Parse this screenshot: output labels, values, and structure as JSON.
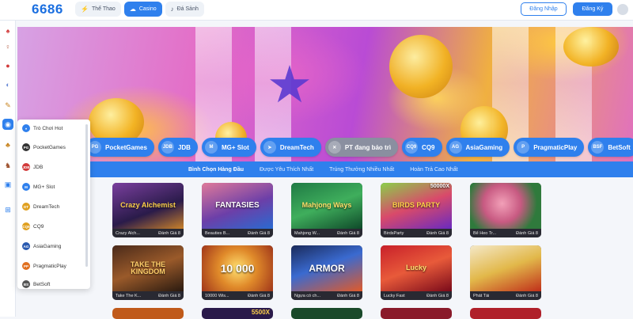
{
  "header": {
    "logo": "6686",
    "tabs": [
      {
        "label": "Thể Thao",
        "icon": "lightning-icon"
      },
      {
        "label": "Casino",
        "icon": "cloud-icon"
      },
      {
        "label": "Đá Sảnh",
        "icon": "mic-icon"
      }
    ],
    "login_label": "Đăng Nhập",
    "register_label": "Đăng Ký"
  },
  "providers": [
    {
      "abbr": "PG",
      "label": "PocketGames"
    },
    {
      "abbr": "JDB",
      "label": "JDB"
    },
    {
      "abbr": "M",
      "label": "MG+ Slot"
    },
    {
      "abbr": "➤",
      "label": "DreamTech"
    },
    {
      "abbr": "✕",
      "label": "PT đang bảo trì"
    },
    {
      "abbr": "CQ9",
      "label": "CQ9"
    },
    {
      "abbr": "AG",
      "label": "AsiaGaming"
    },
    {
      "abbr": "P",
      "label": "PragmaticPlay"
    },
    {
      "abbr": "BSF",
      "label": "BetSoft"
    }
  ],
  "filters": [
    "Bình Chọn Hàng Đầu",
    "Được Yêu Thích Nhất",
    "Trúng Thưởng Nhiều Nhất",
    "Hoàn Trả Cao Nhất"
  ],
  "games": [
    {
      "art": "Crazy Alchemist",
      "name": "Crazy Alch...",
      "rating": "Đánh Giá 8"
    },
    {
      "art": "FANTASIES",
      "name": "Beauties B...",
      "rating": "Đánh Giá 8"
    },
    {
      "art": "Mahjong Ways",
      "name": "Mahjong W...",
      "rating": "Đánh Giá 8"
    },
    {
      "art": "BIRDS PARTY",
      "name": "BirdsParty",
      "rating": "Đánh Giá 8"
    },
    {
      "art": "",
      "name": "Bể Heo Tr...",
      "rating": "Đánh Giá 8"
    },
    {
      "art": "TAKE THE KINGDOM",
      "name": "Take The K...",
      "rating": "Đánh Giá 8"
    },
    {
      "art": "10 000",
      "name": "10000 Wis...",
      "rating": "Đánh Giá 8"
    },
    {
      "art": "ARMOR",
      "name": "Ngựa có ch...",
      "rating": "Đánh Giá 8"
    },
    {
      "art": "Lucky",
      "name": "Lucky Fast",
      "rating": "Đánh Giá 8"
    },
    {
      "art": "",
      "name": "Phát Tài",
      "rating": "Đánh Giá 8"
    }
  ],
  "game_badges": {
    "birds": "50000X",
    "bottom": "5500X"
  },
  "dropdown": [
    {
      "abbr": "♦",
      "label": "Trò Chơi Hot"
    },
    {
      "abbr": "PG",
      "label": "PocketGames"
    },
    {
      "abbr": "JDB",
      "label": "JDB"
    },
    {
      "abbr": "M",
      "label": "MG+ Slot"
    },
    {
      "abbr": "DT",
      "label": "DreamTech"
    },
    {
      "abbr": "CQ9",
      "label": "CQ9"
    },
    {
      "abbr": "AG",
      "label": "AsiaGaming"
    },
    {
      "abbr": "PP",
      "label": "PragmaticPlay"
    },
    {
      "abbr": "BS",
      "label": "BetSoft"
    }
  ],
  "colors": {
    "primary": "#2f80ed",
    "maintenance": "#8a8fa0"
  }
}
